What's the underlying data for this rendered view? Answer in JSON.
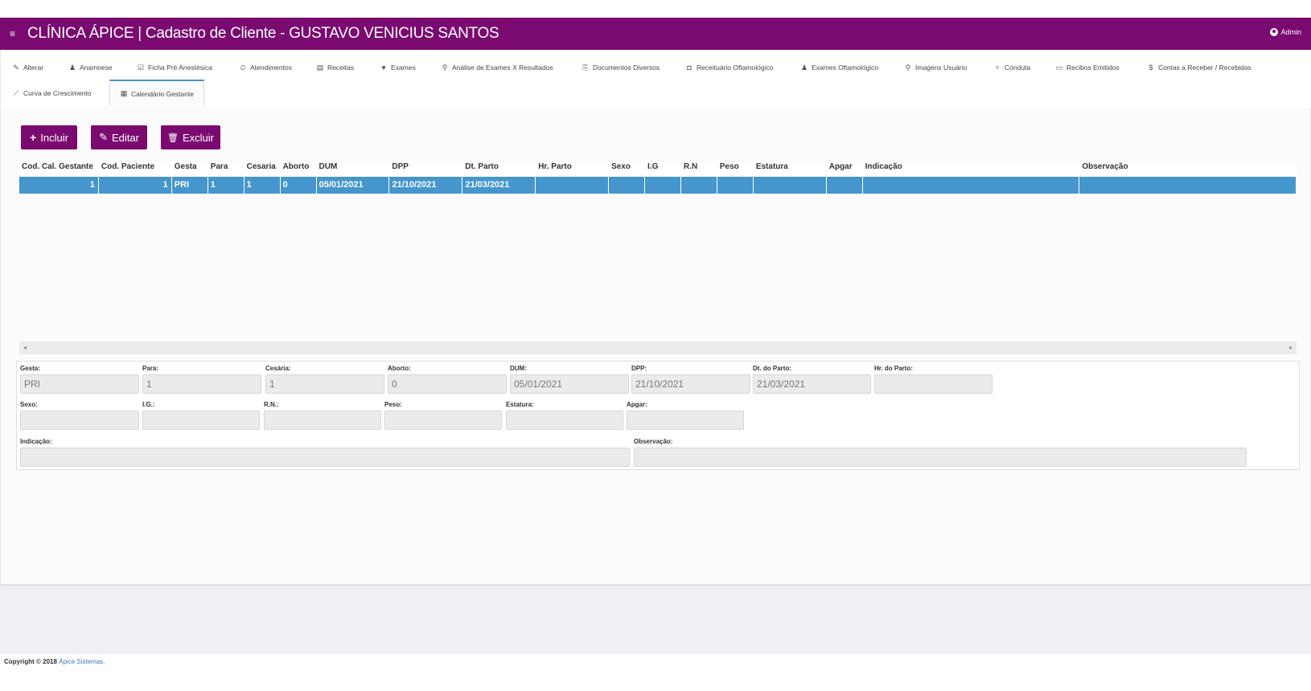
{
  "header": {
    "menu_icon": "hamburger-icon",
    "title": "CLÍNICA ÁPICE | Cadastro de Cliente - GUSTAVO VENICIUS SANTOS",
    "user": "Admin",
    "bg_color": "#7a0a70"
  },
  "tabs": [
    {
      "label": "Alterar",
      "icon": "✎"
    },
    {
      "label": "Anamnese",
      "icon": "♟"
    },
    {
      "label": "Ficha Pré Anestésica",
      "icon": "☑"
    },
    {
      "label": "Atendimentos",
      "icon": "⏲"
    },
    {
      "label": "Receitas",
      "icon": "▤"
    },
    {
      "label": "Exames",
      "icon": "♥"
    },
    {
      "label": "Análise de Exames X Resultados",
      "icon": "⚲"
    },
    {
      "label": "Documentos Diversos",
      "icon": "⎘"
    },
    {
      "label": "Receituário Oftamológico",
      "icon": "◘"
    },
    {
      "label": "Exames Oftamológico",
      "icon": "♟"
    },
    {
      "label": "Imagens Usuário",
      "icon": "⚲"
    },
    {
      "label": "Conduta",
      "icon": "♆"
    },
    {
      "label": "Recibos Emitidos",
      "icon": "▭"
    },
    {
      "label": "Contas a Receber / Recebidas",
      "icon": "$"
    },
    {
      "label": "Curva de Crescimento",
      "icon": "⟋"
    },
    {
      "label": "Calendário Gestante",
      "icon": "▦",
      "active": true
    }
  ],
  "toolbar": {
    "incluir": "Incluir",
    "editar": "Editar",
    "excluir": "Excluir"
  },
  "grid": {
    "columns": [
      "Cod. Cal. Gestante",
      "Cod. Paciente",
      "Gesta",
      "Para",
      "Cesaria",
      "Aborto",
      "DUM",
      "DPP",
      "Dt. Parto",
      "Hr. Parto",
      "Sexo",
      "I.G",
      "R.N",
      "Peso",
      "Estatura",
      "Apgar",
      "Indicação",
      "Observação"
    ],
    "rows": [
      [
        "1",
        "1",
        "PRI",
        "1",
        "1",
        "0",
        "05/01/2021",
        "21/10/2021",
        "21/03/2021",
        "",
        "",
        "",
        "",
        "",
        "",
        "",
        "",
        ""
      ]
    ],
    "selected_color": "#4596cc"
  },
  "form": {
    "gesta": {
      "label": "Gesta:",
      "value": "PRI"
    },
    "para": {
      "label": "Para:",
      "value": "1"
    },
    "cesaria": {
      "label": "Cesária:",
      "value": "1"
    },
    "aborto": {
      "label": "Aborto:",
      "value": "0"
    },
    "dum": {
      "label": "DUM:",
      "value": "05/01/2021"
    },
    "dpp": {
      "label": "DPP:",
      "value": "21/10/2021"
    },
    "dt_parto": {
      "label": "Dt. do Parto:",
      "value": "21/03/2021"
    },
    "hr_parto": {
      "label": "Hr. do Parto:",
      "value": ""
    },
    "sexo": {
      "label": "Sexo:",
      "value": ""
    },
    "ig": {
      "label": "I.G.:",
      "value": ""
    },
    "rn": {
      "label": "R.N.:",
      "value": ""
    },
    "peso": {
      "label": "Peso:",
      "value": ""
    },
    "estatura": {
      "label": "Estatura:",
      "value": ""
    },
    "apgar": {
      "label": "Apgar:",
      "value": ""
    },
    "indicacao": {
      "label": "Indicação:",
      "value": ""
    },
    "observacao": {
      "label": "Observação:",
      "value": ""
    }
  },
  "footer": {
    "text": "Copyright © 2018 ",
    "link": "Ápice Sistemas."
  }
}
